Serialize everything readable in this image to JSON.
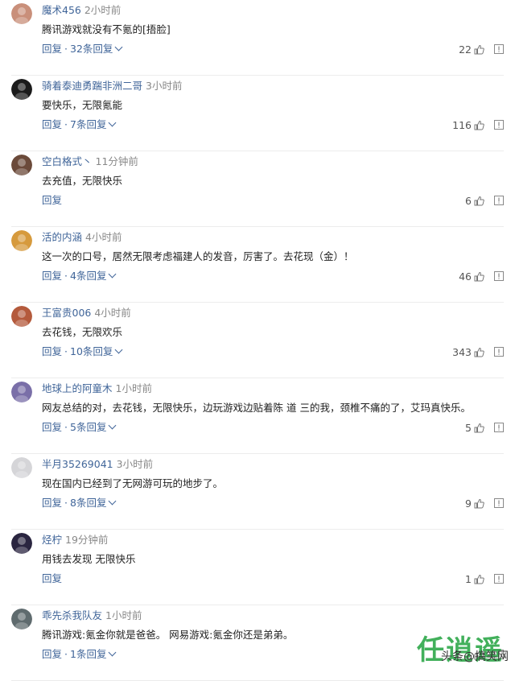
{
  "comments": [
    {
      "user": "魔术456",
      "time": "2小时前",
      "text": "腾讯游戏就没有不氪的[捂脸]",
      "reply_label": "回复",
      "replies": "32条回复",
      "likes": "22",
      "avatar_color": "#c98f7a"
    },
    {
      "user": "骑着泰迪勇踹非洲二哥",
      "time": "3小时前",
      "text": "要快乐，无限氪能",
      "reply_label": "回复",
      "replies": "7条回复",
      "likes": "116",
      "avatar_color": "#1b1b1b"
    },
    {
      "user": "空白格式丶",
      "time": "11分钟前",
      "text": "去充值，无限快乐",
      "reply_label": "回复",
      "replies": "",
      "likes": "6",
      "avatar_color": "#6b4a3a"
    },
    {
      "user": "活的内涵",
      "time": "4小时前",
      "text": "这一次的口号，居然无限考虑福建人的发音，厉害了。去花现（金）！",
      "reply_label": "回复",
      "replies": "4条回复",
      "likes": "46",
      "avatar_color": "#d69a3d"
    },
    {
      "user": "王富贵006",
      "time": "4小时前",
      "text": "去花钱，无限欢乐",
      "reply_label": "回复",
      "replies": "10条回复",
      "likes": "343",
      "avatar_color": "#b45a3c"
    },
    {
      "user": "地球上的阿童木",
      "time": "1小时前",
      "text": "网友总结的对，去花钱，无限快乐，边玩游戏边贴着陈 道 三的我，颈椎不痛的了，艾玛真快乐。",
      "reply_label": "回复",
      "replies": "5条回复",
      "likes": "5",
      "avatar_color": "#7a6fa8"
    },
    {
      "user": "半月35269041",
      "time": "3小时前",
      "text": "现在国内已经到了无网游可玩的地步了。",
      "reply_label": "回复",
      "replies": "8条回复",
      "likes": "9",
      "avatar_color": "#d5d5d8"
    },
    {
      "user": "烃柠",
      "time": "19分钟前",
      "text": "用钱去发现 无限快乐",
      "reply_label": "回复",
      "replies": "",
      "likes": "1",
      "avatar_color": "#2a2540"
    },
    {
      "user": "乖先杀我队友",
      "time": "1小时前",
      "text": "腾讯游戏:氪金你就是爸爸。 网易游戏:氪金你还是弟弟。",
      "reply_label": "回复",
      "replies": "1条回复",
      "likes": "",
      "avatar_color": "#5f6b6e"
    }
  ],
  "separator": "·",
  "watermark": {
    "text": "头条@搞笑网",
    "logo": "任逍遥"
  }
}
